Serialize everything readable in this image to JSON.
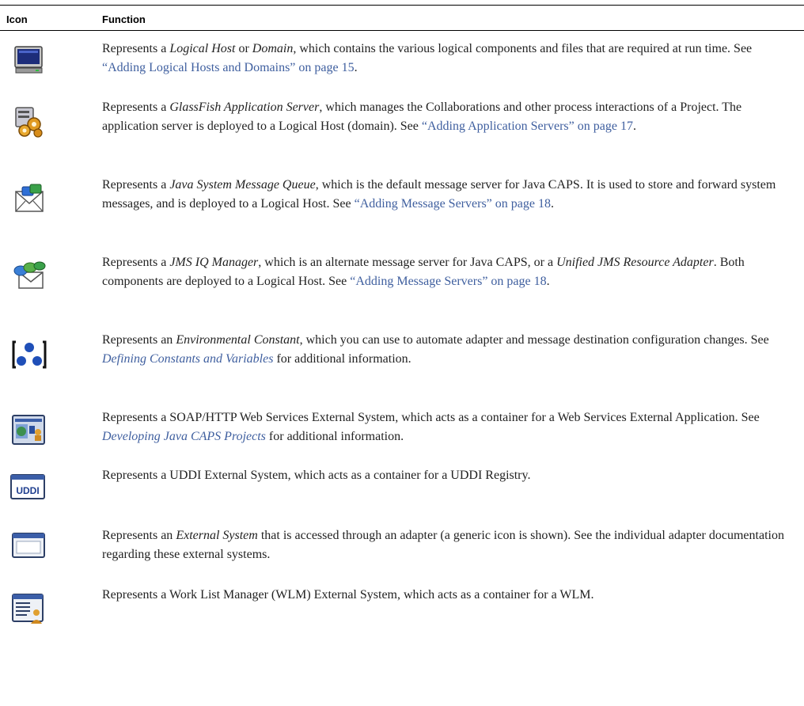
{
  "table": {
    "header": {
      "icon": "Icon",
      "function": "Function"
    },
    "rows": [
      {
        "icon": "logical-host-icon",
        "t1": "Represents a ",
        "e1": "Logical Host",
        "t2": " or ",
        "e2": "Domain",
        "t3": ", which contains the various logical components and files that are required at run time. See ",
        "link": "“Adding Logical Hosts and Domains” on page 15",
        "t4": "."
      },
      {
        "icon": "application-server-icon",
        "t1": "Represents a ",
        "e1": "GlassFish Application Server",
        "t2": ", which manages the Collaborations and other process interactions of a Project. The application server is deployed to a Logical Host (domain). See ",
        "link": "“Adding Application Servers” on page 17",
        "t3": "."
      },
      {
        "icon": "message-queue-icon",
        "t1": "Represents a ",
        "e1": "Java System Message Queue",
        "t2": ", which is the default message server for Java CAPS. It is used to store and forward system messages, and is deployed to a Logical Host. See ",
        "link": "“Adding Message Servers” on page 18",
        "t3": "."
      },
      {
        "icon": "jms-iq-manager-icon",
        "t1": "Represents a ",
        "e1": "JMS IQ Manager",
        "t2": ", which is an alternate message server for Java CAPS, or a ",
        "e2": "Unified JMS Resource Adapter",
        "t3": ". Both components are deployed to a Logical Host. See ",
        "link": "“Adding Message Servers” on page 18",
        "t4": "."
      },
      {
        "icon": "environmental-constant-icon",
        "t1": "Represents an ",
        "e1": "Environmental Constant",
        "t2": ", which you can use to automate adapter and message destination configuration changes. See ",
        "link": "Defining Constants and Variables",
        "t3": " for additional information."
      },
      {
        "icon": "web-services-system-icon",
        "t1": "Represents a SOAP/HTTP Web Services External System, which acts as a container for a Web Services External Application. See ",
        "link": "Developing Java CAPS Projects",
        "t2": " for additional information."
      },
      {
        "icon": "uddi-system-icon",
        "t1": "Represents a UDDI External System, which acts as a container for a UDDI Registry."
      },
      {
        "icon": "external-system-icon",
        "t1": "Represents an ",
        "e1": "External System",
        "t2": " that is accessed through an adapter (a generic icon is shown). See the individual adapter documentation regarding these external systems."
      },
      {
        "icon": "work-list-manager-icon",
        "t1": "Represents a Work List Manager (WLM) External System, which acts as a container for a WLM."
      }
    ]
  },
  "icons": {
    "uddi_text": "UDDI"
  }
}
